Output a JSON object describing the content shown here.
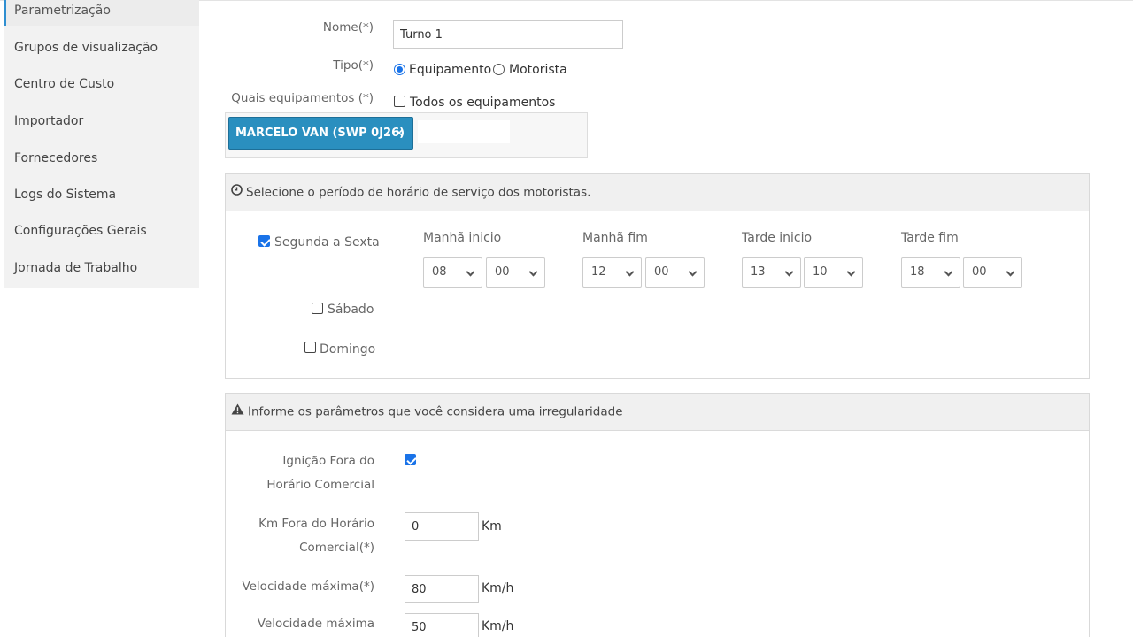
{
  "sidebar": {
    "items": [
      {
        "label": "Parametrização"
      },
      {
        "label": "Grupos de visualização"
      },
      {
        "label": "Centro de Custo"
      },
      {
        "label": "Importador"
      },
      {
        "label": "Fornecedores"
      },
      {
        "label": "Logs do Sistema"
      },
      {
        "label": "Configurações Gerais"
      },
      {
        "label": "Jornada de Trabalho"
      }
    ]
  },
  "form": {
    "nome_label": "Nome(*)",
    "nome_value": "Turno 1",
    "tipo_label": "Tipo(*)",
    "tipo_options": [
      {
        "label": "Equipamento",
        "selected": true
      },
      {
        "label": "Motorista",
        "selected": false
      }
    ],
    "equip_label": "Quais equipamentos (*)",
    "todos_label": "Todos os equipamentos",
    "selected_equipment": "MARCELO VAN (SWP 0J26)",
    "tag_remove": "×"
  },
  "schedule": {
    "title": "Selecione o período de horário de serviço dos motoristas.",
    "columns": [
      "Manhã inicio",
      "Manhã fim",
      "Tarde inicio",
      "Tarde fim"
    ],
    "days": [
      {
        "label": "Segunda a Sexta",
        "checked": true
      },
      {
        "label": "Sábado",
        "checked": false
      },
      {
        "label": "Domingo",
        "checked": false
      }
    ],
    "weekday_times": [
      {
        "hour": "08",
        "minute": "00"
      },
      {
        "hour": "12",
        "minute": "00"
      },
      {
        "hour": "13",
        "minute": "10"
      },
      {
        "hour": "18",
        "minute": "00"
      }
    ]
  },
  "irregular": {
    "title": "Informe os parâmetros que você considera uma irregularidade",
    "ignicao_label_1": "Ignição Fora do",
    "ignicao_label_2": "Horário Comercial",
    "ignicao_checked": true,
    "km_label_1": "Km Fora do Horário",
    "km_label_2": "Comercial(*)",
    "km_value": "0",
    "km_unit": "Km",
    "vel_label": "Velocidade máxima(*)",
    "vel_value": "80",
    "vel_unit": "Km/h",
    "vel2_label": "Velocidade máxima",
    "vel2_value": "50",
    "vel2_unit": "Km/h"
  },
  "colors": {
    "accent": "#1a73e8",
    "tag_bg": "#2a8fbf",
    "active_border": "#2f8fd1"
  },
  "icons": {
    "schedule_head": "clock-icon",
    "irregular_head": "warning-icon"
  }
}
